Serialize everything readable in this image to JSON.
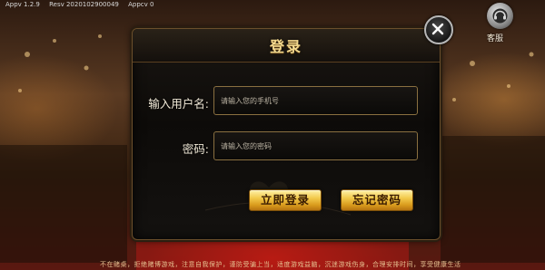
{
  "status_bar": {
    "items": [
      "Appv 1.2.9",
      "Resv 2020102900049",
      "Appcv 0"
    ]
  },
  "customer_service": {
    "icon": "headset-icon",
    "label": "客服"
  },
  "close_button": {
    "icon": "close-icon"
  },
  "login_dialog": {
    "title": "登录",
    "username": {
      "label": "输入用户名:",
      "value": "",
      "placeholder": "请输入您的手机号"
    },
    "password": {
      "label": "密码:",
      "value": "",
      "placeholder": "请输入您的密码"
    },
    "login_button": "立即登录",
    "forgot_button": "忘记密码"
  },
  "ticker": {
    "text": "不在赌桌，拒绝赌博游戏，注意自我保护，谨防受骗上当，适度游戏益脑，沉迷游戏伤身，合理安排时间，享受健康生活"
  },
  "colors": {
    "accent_gold": "#f3d98e",
    "button_gold": "#f2c94a",
    "border_gold": "#8a7040"
  }
}
